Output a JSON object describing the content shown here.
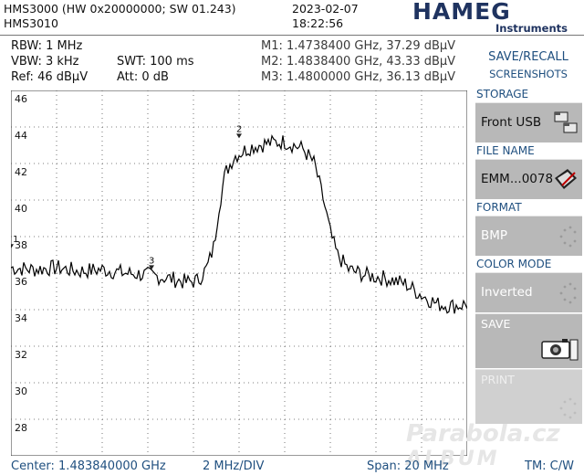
{
  "header": {
    "model_line": "HMS3000 (HW 0x20000000; SW 01.243)",
    "device": "HMS3010",
    "date": "2023-02-07",
    "time": "18:22:56",
    "brand": "HAMEG",
    "brand_sub": "Instruments"
  },
  "settings": {
    "rbw": "RBW: 1 MHz",
    "vbw": "VBW: 3 kHz",
    "swt": "SWT: 100 ms",
    "ref": "Ref: 46 dBµV",
    "att": "Att: 0 dB"
  },
  "markers": {
    "m1": "M1: 1.4738400 GHz, 37.29 dBµV",
    "m2": "M2: 1.4838400 GHz, 43.33 dBµV",
    "m3": "M3: 1.4800000 GHz, 36.13 dBµV"
  },
  "menu": {
    "title_line1": "SAVE/RECALL",
    "title_line2": "SCREENSHOTS",
    "storage_label": "STORAGE",
    "storage_value": "Front USB",
    "filename_label": "FILE NAME",
    "filename_value": "EMM...0078",
    "format_label": "FORMAT",
    "format_value": "BMP",
    "color_label": "COLOR MODE",
    "color_value": "Inverted",
    "save_label": "SAVE",
    "print_label": "PRINT"
  },
  "footer": {
    "center": "Center: 1.483840000 GHz",
    "div": "2 MHz/DIV",
    "span": "Span: 20 MHz",
    "tm": "TM: C/W"
  },
  "watermark": {
    "line1": "Parabola.cz",
    "line2": "ALBUM"
  },
  "chart_data": {
    "type": "line",
    "ylim": [
      26,
      46
    ],
    "yticks": [
      "46",
      "44",
      "42",
      "40",
      "38",
      "36",
      "34",
      "32",
      "30",
      "28",
      "26"
    ],
    "x_unit": "MHz offset from center",
    "xlim": [
      -10,
      10
    ],
    "series": [
      {
        "points": [
          [
            -10,
            36.3
          ],
          [
            -9,
            36.2
          ],
          [
            -8,
            36.3
          ],
          [
            -7,
            36.1
          ],
          [
            -6,
            36.2
          ],
          [
            -5,
            36.0
          ],
          [
            -4,
            35.9
          ],
          [
            -3,
            35.7
          ],
          [
            -2.3,
            35.5
          ],
          [
            -1.8,
            35.6
          ],
          [
            -1.4,
            36.3
          ],
          [
            -1.1,
            37.5
          ],
          [
            -0.9,
            39.5
          ],
          [
            -0.6,
            41.5
          ],
          [
            -0.2,
            42.4
          ],
          [
            0.5,
            42.9
          ],
          [
            1.2,
            43.1
          ],
          [
            2.0,
            43.2
          ],
          [
            2.8,
            42.8
          ],
          [
            3.3,
            42.0
          ],
          [
            3.7,
            40.0
          ],
          [
            4.0,
            38.2
          ],
          [
            4.3,
            37.0
          ],
          [
            4.8,
            36.2
          ],
          [
            5.5,
            35.9
          ],
          [
            6.5,
            35.7
          ],
          [
            7.3,
            35.4
          ],
          [
            8.0,
            34.8
          ],
          [
            8.7,
            34.3
          ],
          [
            9.4,
            34.2
          ],
          [
            10,
            34.3
          ]
        ]
      }
    ],
    "markers": [
      {
        "label": "1",
        "x": -10,
        "y": 37.29
      },
      {
        "label": "2",
        "x": 0,
        "y": 43.33
      },
      {
        "label": "3",
        "x": -3.84,
        "y": 36.13
      }
    ],
    "grid": true
  }
}
